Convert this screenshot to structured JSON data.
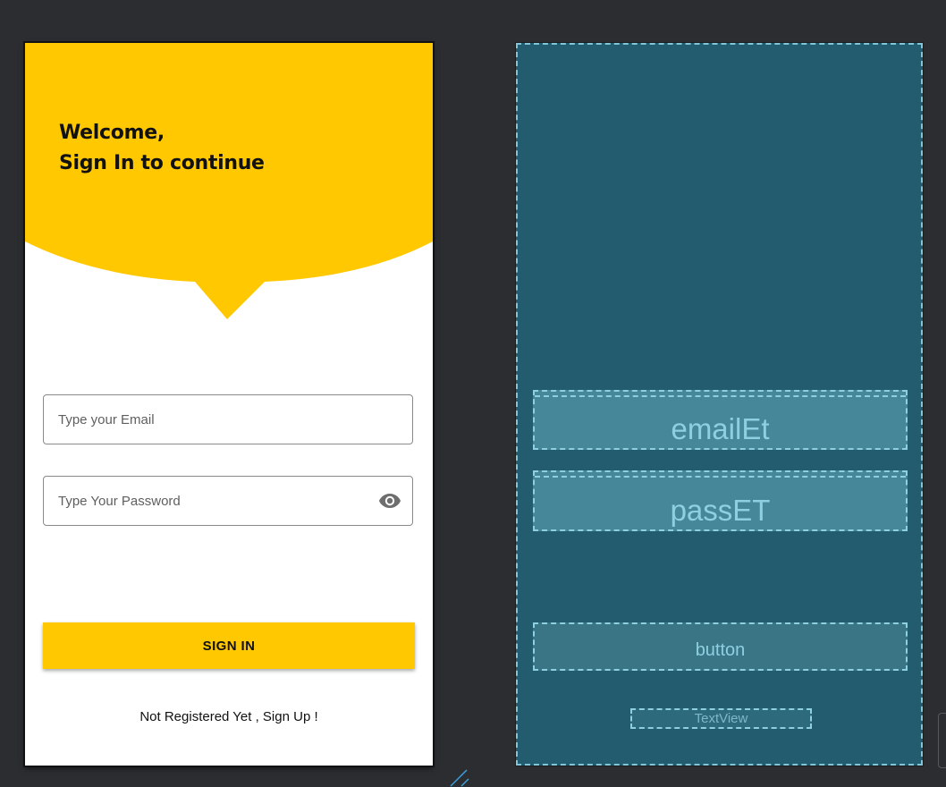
{
  "design_view": {
    "header": {
      "line1": "Welcome,",
      "line2": "Sign In to continue"
    },
    "email_field": {
      "placeholder": "Type your Email",
      "value": ""
    },
    "password_field": {
      "placeholder": "Type Your Password",
      "value": "",
      "toggle_icon": "eye-icon"
    },
    "sign_in_button": {
      "label": "SIGN IN"
    },
    "signup_link": {
      "text": "Not Registered Yet , Sign Up !"
    }
  },
  "blueprint_view": {
    "email_label": "emailEt",
    "pass_label": "passET",
    "button_label": "button",
    "textview_label": "TextView"
  },
  "colors": {
    "accent": "#ffc800",
    "editor_background": "#2b2d31",
    "blueprint_background": "#235c6e",
    "blueprint_outline": "#8fd0e0"
  }
}
